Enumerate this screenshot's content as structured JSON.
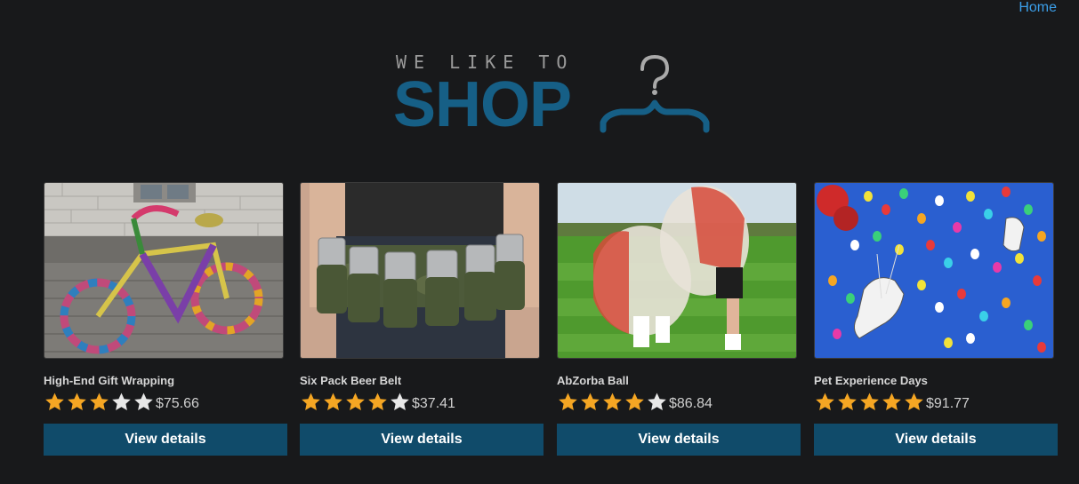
{
  "nav": {
    "home_label": "Home"
  },
  "logo": {
    "line1": "WE LIKE TO",
    "line2": "SHOP",
    "icon": "hanger-icon"
  },
  "colors": {
    "background": "#18191b",
    "brand": "#165f86",
    "button": "#104b6a",
    "link": "#3b9ee8",
    "star_filled": "#f5a623",
    "star_empty": "#e8e8e8"
  },
  "products": [
    {
      "name": "High-End Gift Wrapping",
      "rating": 3,
      "max_rating": 5,
      "price": "$75.66",
      "cta": "View details",
      "image": "knitted-bicycle-image"
    },
    {
      "name": "Six Pack Beer Belt",
      "rating": 4,
      "max_rating": 5,
      "price": "$37.41",
      "cta": "View details",
      "image": "beer-belt-image"
    },
    {
      "name": "AbZorba Ball",
      "rating": 4,
      "max_rating": 5,
      "price": "$86.84",
      "cta": "View details",
      "image": "zorb-ball-image"
    },
    {
      "name": "Pet Experience Days",
      "rating": 5,
      "max_rating": 5,
      "price": "$91.77",
      "cta": "View details",
      "image": "balloon-dogs-image"
    }
  ]
}
